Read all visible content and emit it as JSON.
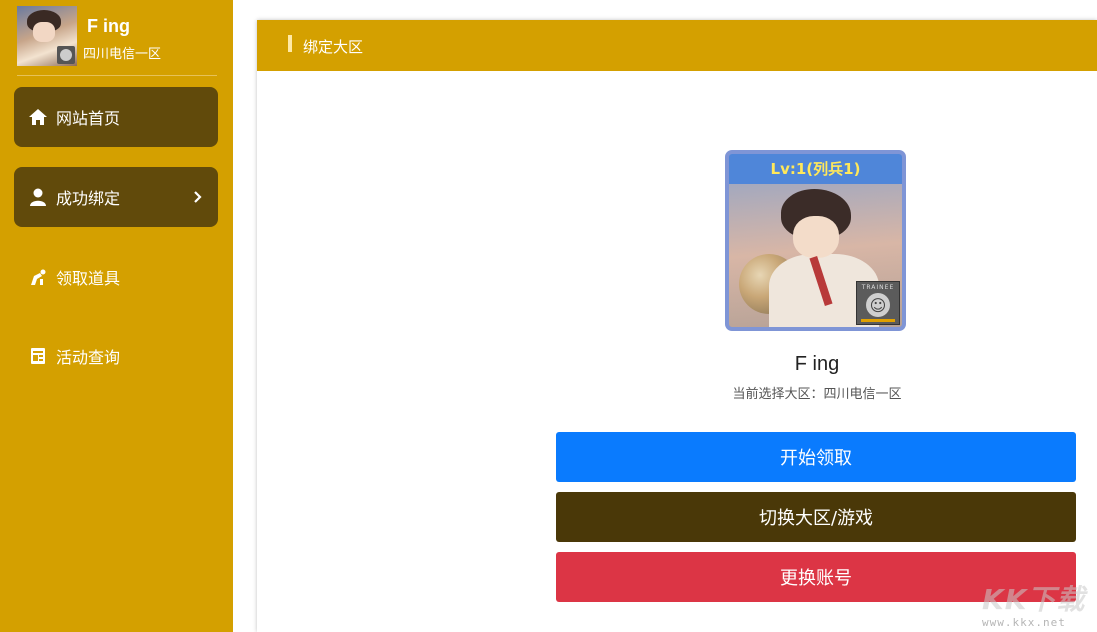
{
  "sidebar": {
    "profile": {
      "name": "F ing",
      "server": "四川电信一区"
    },
    "items": [
      {
        "label": "网站首页",
        "icon": "home-icon",
        "active": true
      },
      {
        "label": "成功绑定",
        "icon": "user-icon",
        "active": true,
        "chevron": "chevron-right-icon"
      },
      {
        "label": "领取道具",
        "icon": "gift-icon",
        "active": false
      },
      {
        "label": "活动查询",
        "icon": "document-icon",
        "active": false
      }
    ]
  },
  "panel": {
    "header_title": "绑定大区",
    "card": {
      "level": "Lv:1(列兵1)",
      "rank_badge": "TRAINEE"
    },
    "player_name": "F ing",
    "server_info": "当前选择大区：四川电信一区",
    "buttons": {
      "start": "开始领取",
      "switch": "切换大区/游戏",
      "change_account": "更换账号"
    }
  },
  "watermark": {
    "big": "KK下载",
    "small": "www.kkx.net"
  },
  "colors": {
    "sidebar": "#d4a000",
    "active_item": "#614a0b",
    "primary": "#0a7bfe",
    "dark": "#4a3808",
    "danger": "#dc3545"
  }
}
